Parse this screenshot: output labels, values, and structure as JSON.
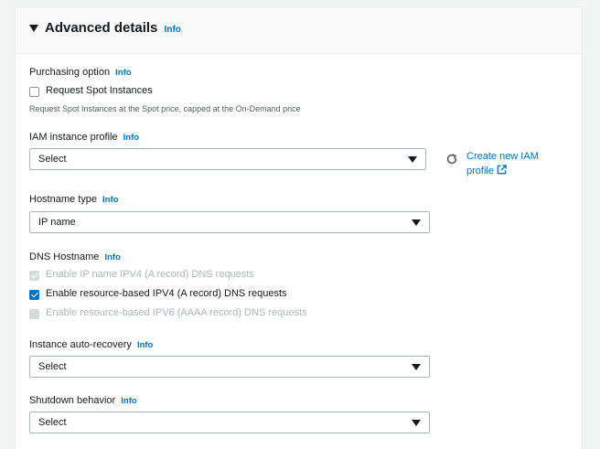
{
  "section": {
    "title": "Advanced details",
    "info": "Info"
  },
  "purchasing": {
    "label": "Purchasing option",
    "info": "Info",
    "checkbox_label": "Request Spot Instances",
    "description": "Request Spot Instances at the Spot price, capped at the On-Demand price"
  },
  "iam": {
    "label": "IAM instance profile",
    "info": "Info",
    "value": "Select",
    "create_link": "Create new IAM profile"
  },
  "hostname": {
    "label": "Hostname type",
    "info": "Info",
    "value": "IP name"
  },
  "dns": {
    "label": "DNS Hostname",
    "info": "Info",
    "options": [
      {
        "label": "Enable IP name IPV4 (A record) DNS requests",
        "checked": true,
        "disabled": true
      },
      {
        "label": "Enable resource-based IPV4 (A record) DNS requests",
        "checked": true,
        "disabled": false
      },
      {
        "label": "Enable resource-based IPV6 (AAAA record) DNS requests",
        "checked": false,
        "disabled": true
      }
    ]
  },
  "recovery": {
    "label": "Instance auto-recovery",
    "info": "Info",
    "value": "Select"
  },
  "shutdown": {
    "label": "Shutdown behavior",
    "info": "Info",
    "value": "Select"
  }
}
